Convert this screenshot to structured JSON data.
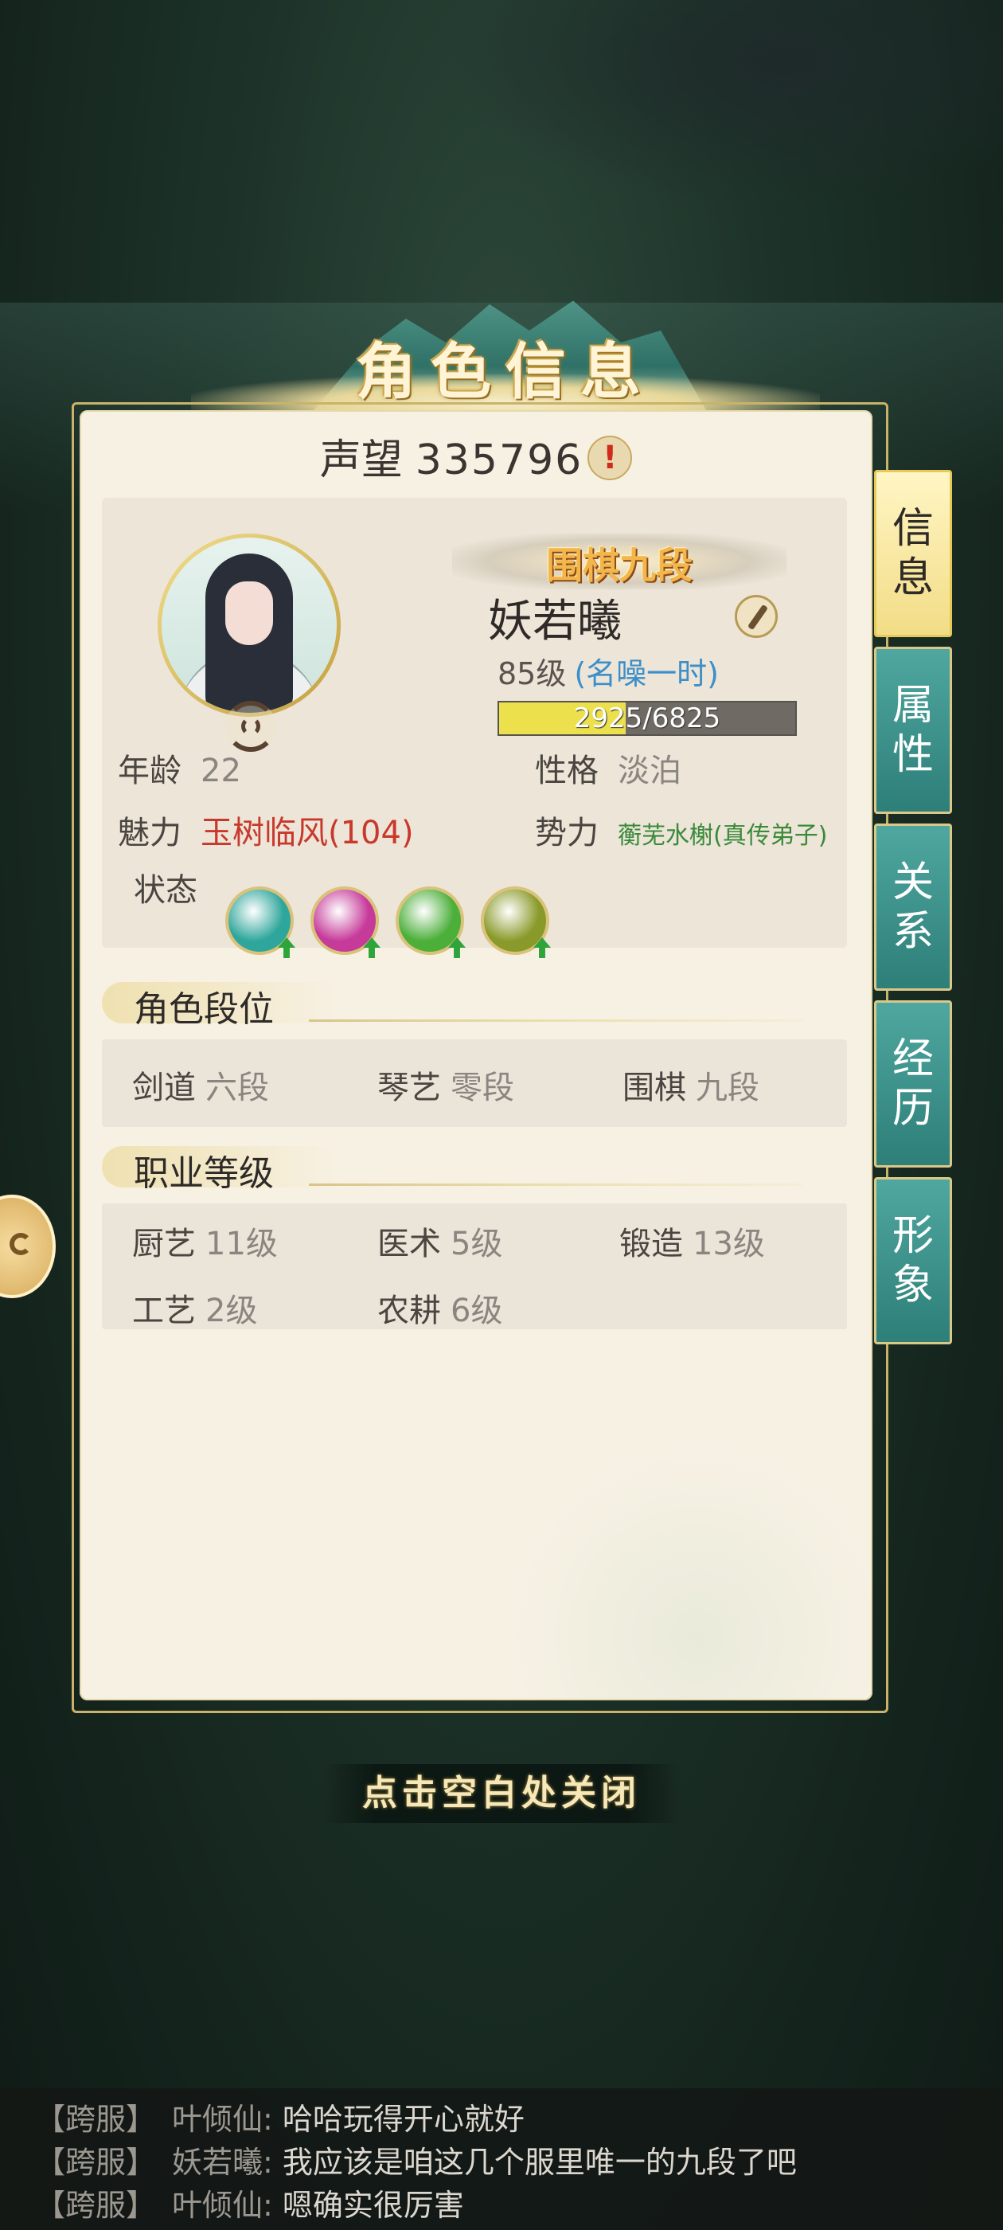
{
  "title": "角色信息",
  "fame": {
    "label": "声望",
    "value": "335796"
  },
  "profile": {
    "rank_badge": "围棋九段",
    "name": "妖若曦",
    "level": "85级",
    "level_title": "(名噪一时)",
    "exp": {
      "current": 2925,
      "max": 6825,
      "text": "2925/6825"
    }
  },
  "attributes": {
    "age_label": "年龄",
    "age_value": "22",
    "personality_label": "性格",
    "personality_value": "淡泊",
    "charm_label": "魅力",
    "charm_value": "玉树临风(104)",
    "faction_label": "势力",
    "faction_value": "蘅芜水榭(真传弟子)",
    "status_label": "状态"
  },
  "status_icons": [
    {
      "icon": "eye-icon",
      "color": "#2fa69c"
    },
    {
      "icon": "flower-icon",
      "color": "#c63a9a"
    },
    {
      "icon": "strength-icon",
      "color": "#4caf3a"
    },
    {
      "icon": "bowl-icon",
      "color": "#8a9a2a"
    }
  ],
  "sections": {
    "role_rank": {
      "title": "角色段位",
      "items": [
        {
          "label": "剑道",
          "value": "六段"
        },
        {
          "label": "琴艺",
          "value": "零段"
        },
        {
          "label": "围棋",
          "value": "九段"
        }
      ]
    },
    "profession": {
      "title": "职业等级",
      "items": [
        {
          "label": "厨艺",
          "value": "11级"
        },
        {
          "label": "医术",
          "value": "5级"
        },
        {
          "label": "锻造",
          "value": "13级"
        },
        {
          "label": "工艺",
          "value": "2级"
        },
        {
          "label": "农耕",
          "value": "6级"
        }
      ]
    }
  },
  "tabs": [
    {
      "label": "信息",
      "active": true
    },
    {
      "label": "属性",
      "active": false
    },
    {
      "label": "关系",
      "active": false
    },
    {
      "label": "经历",
      "active": false
    },
    {
      "label": "形象",
      "active": false
    }
  ],
  "close_hint": "点击空白处关闭",
  "chat": [
    {
      "channel": "【跨服】",
      "sender": "叶倾仙:",
      "message": "哈哈玩得开心就好"
    },
    {
      "channel": "【跨服】",
      "sender": "妖若曦:",
      "message": "我应该是咱这几个服里唯一的九段了吧"
    },
    {
      "channel": "【跨服】",
      "sender": "叶倾仙:",
      "message": "嗯确实很厉害"
    }
  ]
}
